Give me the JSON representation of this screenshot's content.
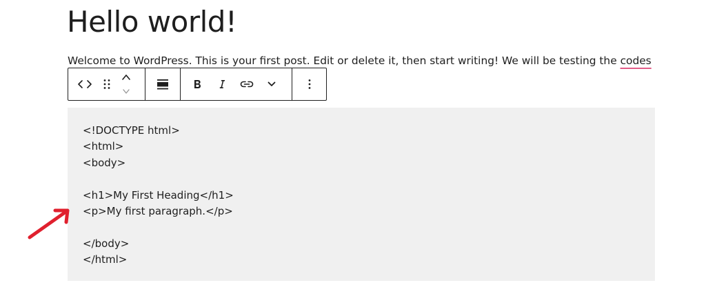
{
  "post": {
    "title": "Hello world!",
    "intro_main": "Welcome to WordPress. This is your first post. Edit or delete it, then start writing! We will be testing the ",
    "intro_flagged_word": "codes"
  },
  "toolbar": {
    "buttons": [
      {
        "name": "block-type-code",
        "icon": "code-icon"
      },
      {
        "name": "drag-handle",
        "icon": "drag-handle-icon"
      },
      {
        "name": "move-up",
        "icon": "chevron-up-icon"
      },
      {
        "name": "move-down",
        "icon": "chevron-down-icon"
      },
      {
        "name": "align",
        "icon": "align-wide-icon"
      },
      {
        "name": "bold",
        "icon": "bold-icon"
      },
      {
        "name": "italic",
        "icon": "italic-icon"
      },
      {
        "name": "link",
        "icon": "link-icon"
      },
      {
        "name": "more-rich-text",
        "icon": "chevron-down-icon"
      },
      {
        "name": "options",
        "icon": "more-vertical-icon"
      }
    ]
  },
  "code_block": {
    "lines": [
      "<!DOCTYPE html>",
      "<html>",
      "<body>",
      "",
      "<h1>My First Heading</h1>",
      "<p>My first paragraph.</p>",
      "",
      "</body>",
      "</html>"
    ]
  },
  "colors": {
    "text": "#1e1e1e",
    "code_background": "#f0f0f0",
    "spellcheck_underline": "#e25b87",
    "annotation_arrow": "#e0202e"
  }
}
